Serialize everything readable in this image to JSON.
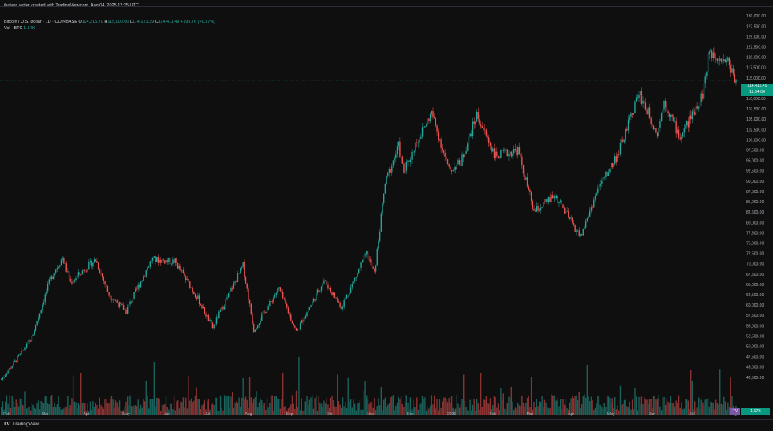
{
  "header": {
    "author_line": "jhaiver_writer created with TradingView.com, Aug 04, 2025 12:25 UTC"
  },
  "legend": {
    "symbol": "Bitcoin / U.S. Dollar · 1D · COINBASE",
    "o_label": "O",
    "o_value": "114,215.70",
    "h_label": "H",
    "h_value": "115,000.00",
    "l_label": "L",
    "l_value": "114,121.39",
    "c_label": "C",
    "c_value": "114,411.49",
    "change": "+195.76 (+0.17%)",
    "vol_label": "Vol · BTC",
    "vol_value": "1.17K"
  },
  "price_tag": {
    "price": "114,411.49",
    "countdown": "11:34:06"
  },
  "vol_tag": {
    "value": "1.17K",
    "icon_label": "TV"
  },
  "footer": {
    "brand": "TradingView",
    "logo_glyph": "TV"
  },
  "colors": {
    "up": "#26a69a",
    "down": "#ef5350",
    "background": "#0f0f0f",
    "axis_text": "#b2b5be"
  },
  "chart_data": {
    "type": "candlestick",
    "title": "",
    "x_axis_labels": [
      "Feb",
      "Mar",
      "Apr",
      "May",
      "Jun",
      "Jul",
      "Aug",
      "Sep",
      "Oct",
      "Nov",
      "Dec",
      "2025",
      "Feb",
      "Mar",
      "Apr",
      "May",
      "Jun",
      "Jul",
      "Aug"
    ],
    "y_axis_labels": [
      "130,000.00",
      "127,500.00",
      "125,000.00",
      "122,500.00",
      "120,000.00",
      "117,500.00",
      "115,000.00",
      "112,500.00",
      "110,000.00",
      "107,500.00",
      "105,000.00",
      "102,500.00",
      "100,000.00",
      "97,500.00",
      "95,000.00",
      "92,500.00",
      "90,000.00",
      "87,500.00",
      "85,000.00",
      "82,500.00",
      "80,000.00",
      "77,500.00",
      "75,000.00",
      "72,500.00",
      "70,000.00",
      "67,500.00",
      "65,000.00",
      "62,500.00",
      "60,000.00",
      "57,500.00",
      "55,000.00",
      "52,500.00",
      "50,000.00",
      "47,500.00",
      "45,000.00",
      "42,500.00"
    ],
    "ylim": [
      41500,
      131000
    ],
    "last_price": 114411.49,
    "anchors": [
      {
        "date": "2024-01-28",
        "price": 42000
      },
      {
        "date": "2024-02-10",
        "price": 47500
      },
      {
        "date": "2024-02-20",
        "price": 52000
      },
      {
        "date": "2024-03-05",
        "price": 66500
      },
      {
        "date": "2024-03-14",
        "price": 71500
      },
      {
        "date": "2024-03-20",
        "price": 65500
      },
      {
        "date": "2024-04-08",
        "price": 71000
      },
      {
        "date": "2024-04-18",
        "price": 62500
      },
      {
        "date": "2024-05-01",
        "price": 58500
      },
      {
        "date": "2024-05-20",
        "price": 71000
      },
      {
        "date": "2024-06-07",
        "price": 70500
      },
      {
        "date": "2024-06-24",
        "price": 61500
      },
      {
        "date": "2024-07-05",
        "price": 54500
      },
      {
        "date": "2024-07-28",
        "price": 69500
      },
      {
        "date": "2024-08-05",
        "price": 54000
      },
      {
        "date": "2024-08-24",
        "price": 64000
      },
      {
        "date": "2024-09-06",
        "price": 53500
      },
      {
        "date": "2024-09-27",
        "price": 66000
      },
      {
        "date": "2024-10-10",
        "price": 59500
      },
      {
        "date": "2024-10-29",
        "price": 72500
      },
      {
        "date": "2024-11-04",
        "price": 67500
      },
      {
        "date": "2024-11-12",
        "price": 89500
      },
      {
        "date": "2024-11-22",
        "price": 98500
      },
      {
        "date": "2024-11-26",
        "price": 92000
      },
      {
        "date": "2024-12-05",
        "price": 99000
      },
      {
        "date": "2024-12-17",
        "price": 106500
      },
      {
        "date": "2024-12-30",
        "price": 92500
      },
      {
        "date": "2025-01-08",
        "price": 94500
      },
      {
        "date": "2025-01-20",
        "price": 106000
      },
      {
        "date": "2025-02-03",
        "price": 96000
      },
      {
        "date": "2025-02-20",
        "price": 97500
      },
      {
        "date": "2025-03-04",
        "price": 82500
      },
      {
        "date": "2025-03-20",
        "price": 86500
      },
      {
        "date": "2025-04-08",
        "price": 76500
      },
      {
        "date": "2025-04-21",
        "price": 88000
      },
      {
        "date": "2025-05-07",
        "price": 97000
      },
      {
        "date": "2025-05-22",
        "price": 111500
      },
      {
        "date": "2025-06-05",
        "price": 101500
      },
      {
        "date": "2025-06-10",
        "price": 109500
      },
      {
        "date": "2025-06-22",
        "price": 100500
      },
      {
        "date": "2025-07-09",
        "price": 111000
      },
      {
        "date": "2025-07-14",
        "price": 121500
      },
      {
        "date": "2025-07-28",
        "price": 119000
      },
      {
        "date": "2025-08-03",
        "price": 114411
      }
    ]
  }
}
